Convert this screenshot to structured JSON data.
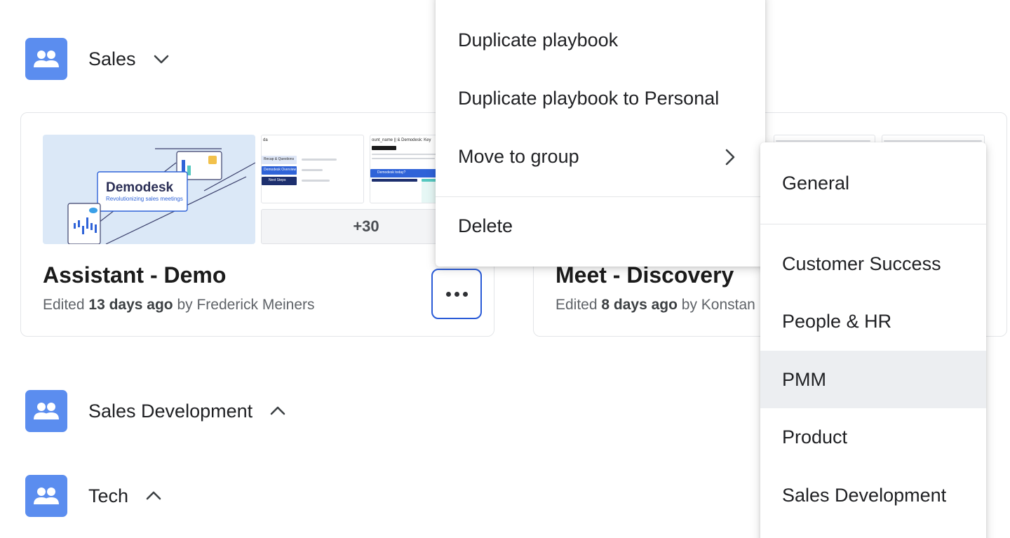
{
  "colors": {
    "group_icon": "#5b8def",
    "focus_ring": "#2a5bd7",
    "active_row": "#eceef1"
  },
  "groups": [
    {
      "title": "Sales",
      "chevron": "chevron-down-icon"
    },
    {
      "title": "Sales Development",
      "chevron": "chevron-up-icon"
    },
    {
      "title": "Tech",
      "chevron": "chevron-up-icon"
    }
  ],
  "cards": [
    {
      "logo_text": "Demodesk",
      "logo_tagline": "Revolutionizing sales meetings",
      "more_count": "+30",
      "title": "Assistant - Demo",
      "meta_prefix": "Edited ",
      "meta_time": "13 days ago",
      "meta_suffix": " by Frederick Meiners",
      "mini1": {
        "heading": "da",
        "rows": [
          "Recap & Questions",
          "Demodesk Overview",
          "Next Steps"
        ]
      },
      "mini2": {
        "heading": "ount_name || & Demodesk: Key",
        "banner": "Demodesk today?"
      }
    },
    {
      "title": "Meet - Discovery",
      "meta_prefix": "Edited ",
      "meta_time": "8 days ago",
      "meta_suffix": " by Konstan"
    }
  ],
  "context_menu": {
    "items": [
      "Duplicate playbook",
      "Duplicate playbook to Personal",
      "Move to group",
      "Delete"
    ]
  },
  "submenu": {
    "items": [
      "General",
      "Customer Success",
      "People & HR",
      "PMM",
      "Product",
      "Sales Development"
    ],
    "active": "PMM"
  }
}
